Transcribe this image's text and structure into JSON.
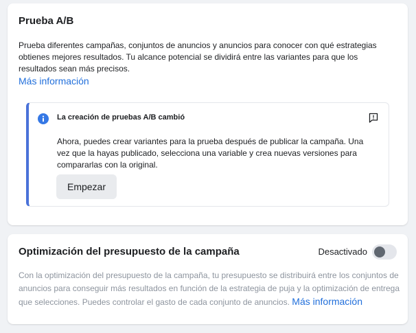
{
  "ab_test": {
    "title": "Prueba A/B",
    "description": "Prueba diferentes campañas, conjuntos de anuncios y anuncios para conocer con qué estrategias obtienes mejores resultados. Tu alcance potencial se dividirá entre las variantes para que los resultados sean más precisos.",
    "learn_more": "Más información",
    "notice": {
      "title": "La creación de pruebas A/B cambió",
      "body": "Ahora, puedes crear variantes para la prueba después de publicar la campaña. Una vez que la hayas publicado, selecciona una variable y crea nuevas versiones para compararlas con la original.",
      "button_label": "Empezar",
      "info_icon": "info-icon",
      "feedback_icon": "feedback-icon"
    }
  },
  "budget_optimization": {
    "title": "Optimización del presupuesto de la campaña",
    "toggle_label": "Desactivado",
    "toggle_on": false,
    "description": "Con la optimización del presupuesto de la campaña, tu presupuesto se distribuirá entre los conjuntos de anuncios para conseguir más resultados en función de la estrategia de puja y la optimización de entrega que selecciones. Puedes controlar el gasto de cada conjunto de anuncios.",
    "learn_more": "Más información"
  },
  "colors": {
    "link": "#216fdb",
    "accent_border": "#4a72d9",
    "info_icon": "#3578e5"
  }
}
